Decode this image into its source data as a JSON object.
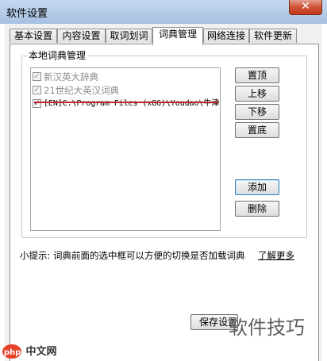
{
  "window": {
    "title": "软件设置",
    "close_glyph": "✕"
  },
  "tabs": [
    {
      "label": "基本设置",
      "active": false
    },
    {
      "label": "内容设置",
      "active": false
    },
    {
      "label": "取词划词",
      "active": false
    },
    {
      "label": "词典管理",
      "active": true
    },
    {
      "label": "网络连接",
      "active": false
    },
    {
      "label": "软件更新",
      "active": false
    }
  ],
  "local_dict": {
    "title": "本地词典管理",
    "items": [
      {
        "label": "新汉英大辞典",
        "checked": true,
        "enabled": false
      },
      {
        "label": "21世纪大英汉词典",
        "checked": true,
        "enabled": false
      },
      {
        "label": "[EN]C:\\Program Files (x86)\\Youdao\\牛津",
        "checked": true,
        "enabled": true
      }
    ],
    "buttons": {
      "top": "置顶",
      "up": "上移",
      "down": "下移",
      "bottom": "置底",
      "add": "添加",
      "remove": "删除"
    }
  },
  "hint": {
    "text": "小提示: 词典前面的选中框可以方便的切换是否加载词典",
    "link": "了解更多"
  },
  "footer": {
    "save_label": "保存设置"
  },
  "watermarks": {
    "text": "软件技巧",
    "logo_text": "php中文网"
  },
  "colors": {
    "annotation_underline": "#c8222a",
    "logo_badge": "#e8412a"
  }
}
